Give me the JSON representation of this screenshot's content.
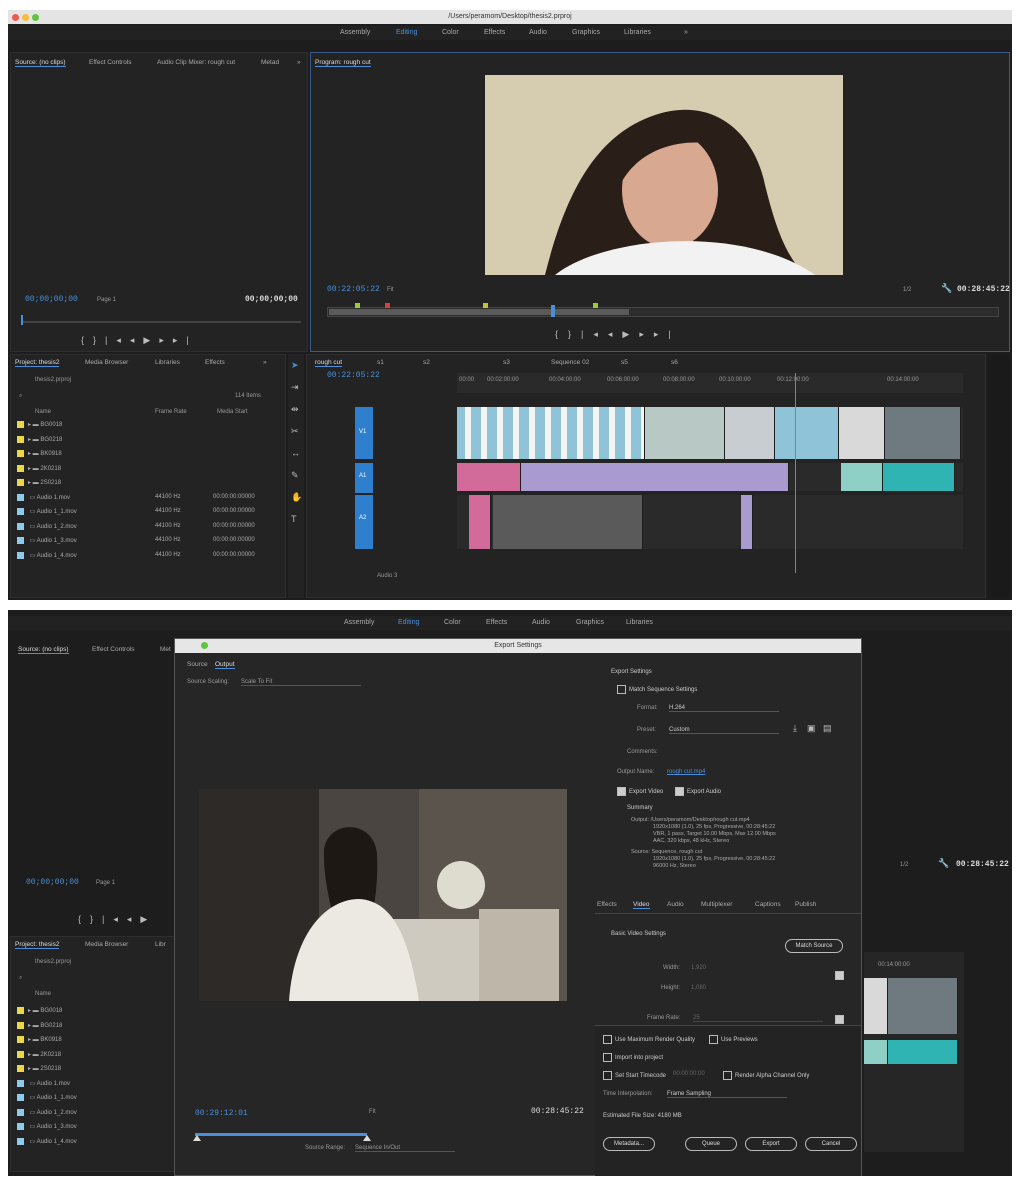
{
  "window": {
    "path": "/Users/peramom/Desktop/thesis2.prproj"
  },
  "workspaces": [
    "Assembly",
    "Editing",
    "Color",
    "Effects",
    "Audio",
    "Graphics",
    "Libraries",
    "»"
  ],
  "top": {
    "source_tabs": [
      "Source: (no clips)",
      "Effect Controls",
      "Audio Clip Mixer: rough cut",
      "Metad",
      "»"
    ],
    "program_tab": "Program: rough cut",
    "source_tc_left": "00;00;00;00",
    "source_page": "Page 1",
    "source_tc_right": "00;00;00;00",
    "program_tc": "00:22:05:22",
    "program_fit": "Fit",
    "program_zoom": "1/2",
    "program_duration": "00:28:45:22",
    "project_tabs": [
      "Project: thesis2",
      "Media Browser",
      "Libraries",
      "Effects",
      "»"
    ],
    "project_file": "thesis2.prproj",
    "item_count": "114 Items",
    "columns": [
      "Name",
      "Frame Rate",
      "Media Start"
    ],
    "rows": [
      {
        "name": "BG0018",
        "rate": "",
        "start": "",
        "color": "#e8d84a"
      },
      {
        "name": "BG0218",
        "rate": "",
        "start": "",
        "color": "#e8d84a"
      },
      {
        "name": "BK0918",
        "rate": "",
        "start": "",
        "color": "#e8d84a"
      },
      {
        "name": "2K0218",
        "rate": "",
        "start": "",
        "color": "#e8d84a"
      },
      {
        "name": "2S0218",
        "rate": "",
        "start": "",
        "color": "#e8d84a"
      },
      {
        "name": "Audio 1.mov",
        "rate": "44100 Hz",
        "start": "00:00:00:00000",
        "color": "#8ecbe8"
      },
      {
        "name": "Audio 1_1.mov",
        "rate": "44100 Hz",
        "start": "00:00:00:00000",
        "color": "#8ecbe8"
      },
      {
        "name": "Audio 1_2.mov",
        "rate": "44100 Hz",
        "start": "00:00:00:00000",
        "color": "#8ecbe8"
      },
      {
        "name": "Audio 1_3.mov",
        "rate": "44100 Hz",
        "start": "00:00:00:00000",
        "color": "#8ecbe8"
      },
      {
        "name": "Audio 1_4.mov",
        "rate": "44100 Hz",
        "start": "00:00:00:00000",
        "color": "#8ecbe8"
      }
    ],
    "timeline_tab": "rough cut",
    "timeline_tc": "00:22:05:22",
    "timeline_other_tabs": [
      "s1",
      "s2",
      "s3",
      "Sequence 02",
      "s5",
      "s6"
    ],
    "tracks": [
      "V1",
      "A1",
      "A2",
      "Audio 3"
    ],
    "ruler": [
      "00:00",
      "00:02:00:00",
      "00:04:00:00",
      "00:06:00:00",
      "00:08:00:00",
      "00:10:00:00",
      "00:12:00:00",
      "00:14:00:00"
    ]
  },
  "bottom": {
    "source_tabs": [
      "Source: (no clips)",
      "Effect Controls",
      "Met"
    ],
    "dialog_title": "Export Settings",
    "dialog_tabs": [
      "Source",
      "Output"
    ],
    "source_scaling_label": "Source Scaling:",
    "source_scaling_value": "Scale To Fit",
    "export_settings_header": "Export Settings",
    "match_sequence": "Match Sequence Settings",
    "format_label": "Format:",
    "format_value": "H.264",
    "preset_label": "Preset:",
    "preset_value": "Custom",
    "comments_label": "Comments:",
    "output_name_label": "Output Name:",
    "output_name_value": "rough cut.mp4",
    "export_video": "Export Video",
    "export_audio": "Export Audio",
    "summary_header": "Summary",
    "summary_output": "Output: /Users/peramom/Desktop/rough cut.mp4",
    "summary_output_2": "1920x1080 (1.0), 25 fps, Progressive, 00:28:45:22",
    "summary_output_3": "VBR, 1 pass, Target 10.00 Mbps, Max 12.00 Mbps",
    "summary_output_4": "AAC, 320 kbps, 48 kHz, Stereo",
    "summary_source": "Source: Sequence, rough cut",
    "summary_source_2": "1920x1080 (1.0), 25 fps, Progressive, 00:28:45:22",
    "summary_source_3": "96000 Hz, Stereo",
    "settings_tabs": [
      "Effects",
      "Video",
      "Audio",
      "Multiplexer",
      "Captions",
      "Publish"
    ],
    "basic_video": "Basic Video Settings",
    "match_source": "Match Source",
    "width_label": "Width:",
    "width_value": "1,920",
    "height_label": "Height:",
    "height_value": "1,080",
    "frame_rate_label": "Frame Rate:",
    "frame_rate_value": "25",
    "max_render": "Use Maximum Render Quality",
    "use_previews": "Use Previews",
    "import_project": "Import into project",
    "start_timecode": "Set Start Timecode",
    "start_timecode_value": "00:00:00:00",
    "alpha_only": "Render Alpha Channel Only",
    "time_interp_label": "Time Interpolation:",
    "time_interp_value": "Frame Sampling",
    "file_size": "Estimated File Size: 4180 MB",
    "btn_metadata": "Metadata...",
    "btn_queue": "Queue",
    "btn_export": "Export",
    "btn_cancel": "Cancel",
    "preview_tc_left": "00:29:12:01",
    "preview_fit": "Fit",
    "preview_tc_right": "00:28:45:22",
    "source_range_label": "Source Range:",
    "source_range_value": "Sequence In/Out",
    "source_tc_left": "00;00;00;00",
    "source_page": "Page 1",
    "program_zoom": "1/2",
    "program_duration": "00:28:45:22",
    "project_tabs": [
      "Project: thesis2",
      "Media Browser",
      "Libr"
    ],
    "project_file": "thesis2.prproj",
    "name_col": "Name",
    "rows": [
      {
        "name": "BG0018",
        "color": "#e8d84a"
      },
      {
        "name": "BG0218",
        "color": "#e8d84a"
      },
      {
        "name": "BK0918",
        "color": "#e8d84a"
      },
      {
        "name": "2K0218",
        "color": "#e8d84a"
      },
      {
        "name": "2S0218",
        "color": "#e8d84a"
      },
      {
        "name": "Audio 1.mov",
        "color": "#8ecbe8"
      },
      {
        "name": "Audio 1_1.mov",
        "color": "#8ecbe8"
      },
      {
        "name": "Audio 1_2.mov",
        "color": "#8ecbe8"
      },
      {
        "name": "Audio 1_3.mov",
        "color": "#8ecbe8"
      },
      {
        "name": "Audio 1_4.mov",
        "color": "#8ecbe8"
      }
    ],
    "right_ruler": "00:14:00:00"
  },
  "colors": {
    "accent": "#4a8fd8",
    "video_clip": "#8fc3d8",
    "audio_clip": "#a99ad0",
    "audio_clip_pink": "#d36b9a",
    "audio_clip_teal": "#2fb3b3",
    "track_target": "#2f7fcf"
  }
}
